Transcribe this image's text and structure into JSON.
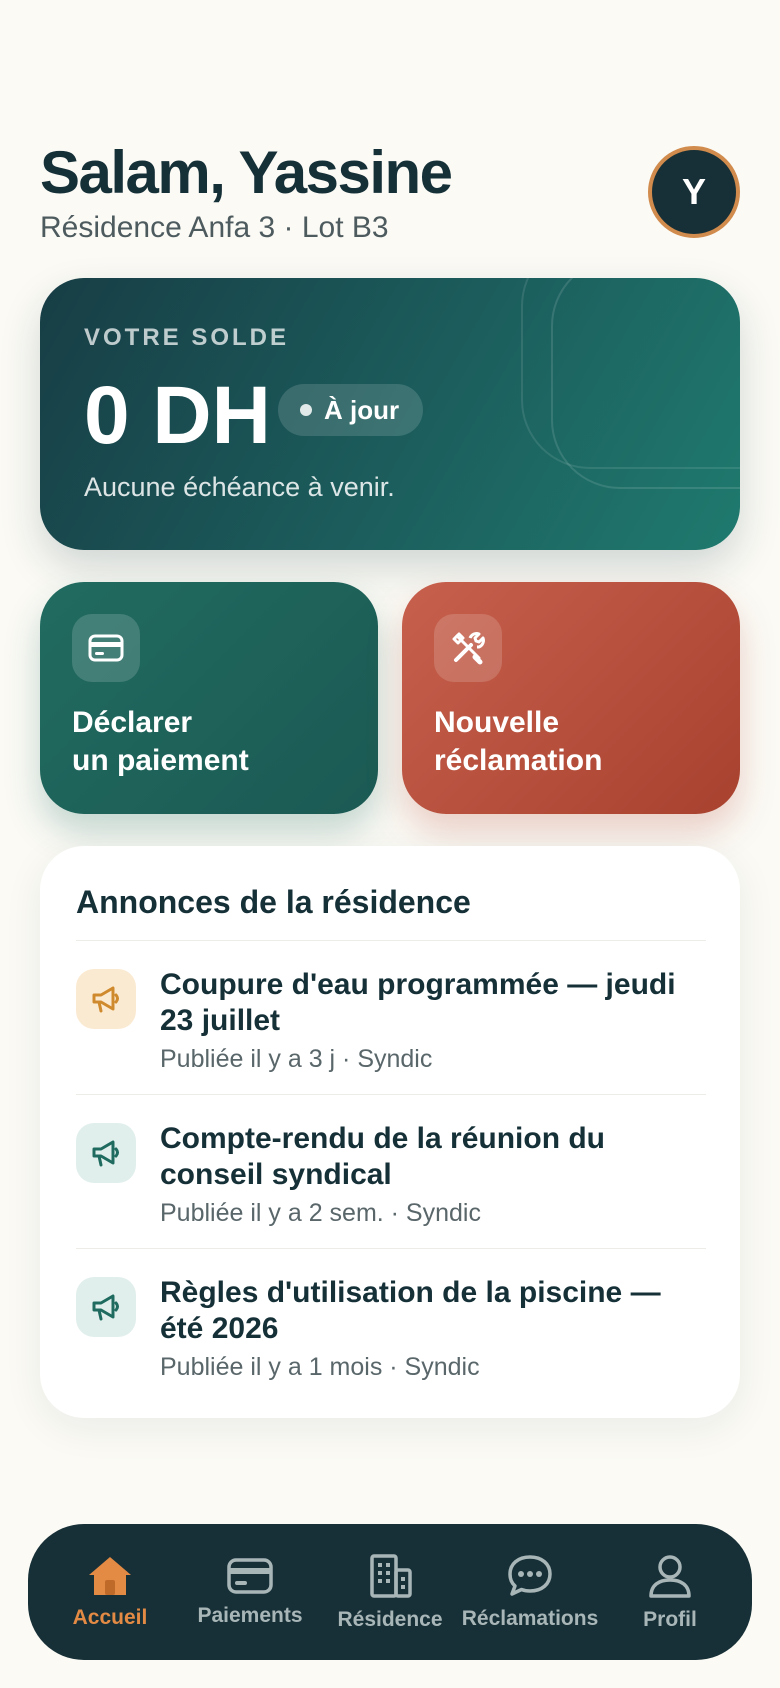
{
  "header": {
    "greeting": "Salam, Yassine",
    "subline": "Résidence Anfa 3 · Lot B3",
    "avatar_initial": "Y"
  },
  "balance": {
    "label": "VOTRE SOLDE",
    "amount": "0 DH",
    "status": "À jour",
    "note": "Aucune échéance à venir."
  },
  "actions": {
    "pay_line1": "Déclarer",
    "pay_line2": "un paiement",
    "pay_icon": "card-icon",
    "claim_line1": "Nouvelle",
    "claim_line2": "réclamation",
    "claim_icon": "tools-icon"
  },
  "announcements": {
    "title": "Annonces de la résidence",
    "items": [
      {
        "title": "Coupure d'eau programmée — jeudi 23 juillet",
        "meta": "Publiée il y a 3 j · Syndic",
        "icon": "megaphone-icon",
        "tone": "#d08a2e"
      },
      {
        "title": "Compte-rendu de la réunion du conseil syndical",
        "meta": "Publiée il y a 2 sem. · Syndic",
        "icon": "megaphone-icon",
        "tone": "#1f6b60"
      },
      {
        "title": "Règles d'utilisation de la piscine — été 2026",
        "meta": "Publiée il y a 1 mois · Syndic",
        "icon": "megaphone-icon",
        "tone": "#1f6b60"
      }
    ]
  },
  "nav": {
    "items": [
      {
        "label": "Accueil",
        "icon": "home-icon",
        "active": true
      },
      {
        "label": "Paiements",
        "icon": "card-icon",
        "active": false
      },
      {
        "label": "Résidence",
        "icon": "building-icon",
        "active": false
      },
      {
        "label": "Réclamations",
        "icon": "chat-icon",
        "active": false
      },
      {
        "label": "Profil",
        "icon": "user-icon",
        "active": false
      }
    ]
  },
  "colors": {
    "accent": "#e38a44",
    "teal": "#1f6b60",
    "terracotta": "#b8503b",
    "dark": "#173037"
  }
}
